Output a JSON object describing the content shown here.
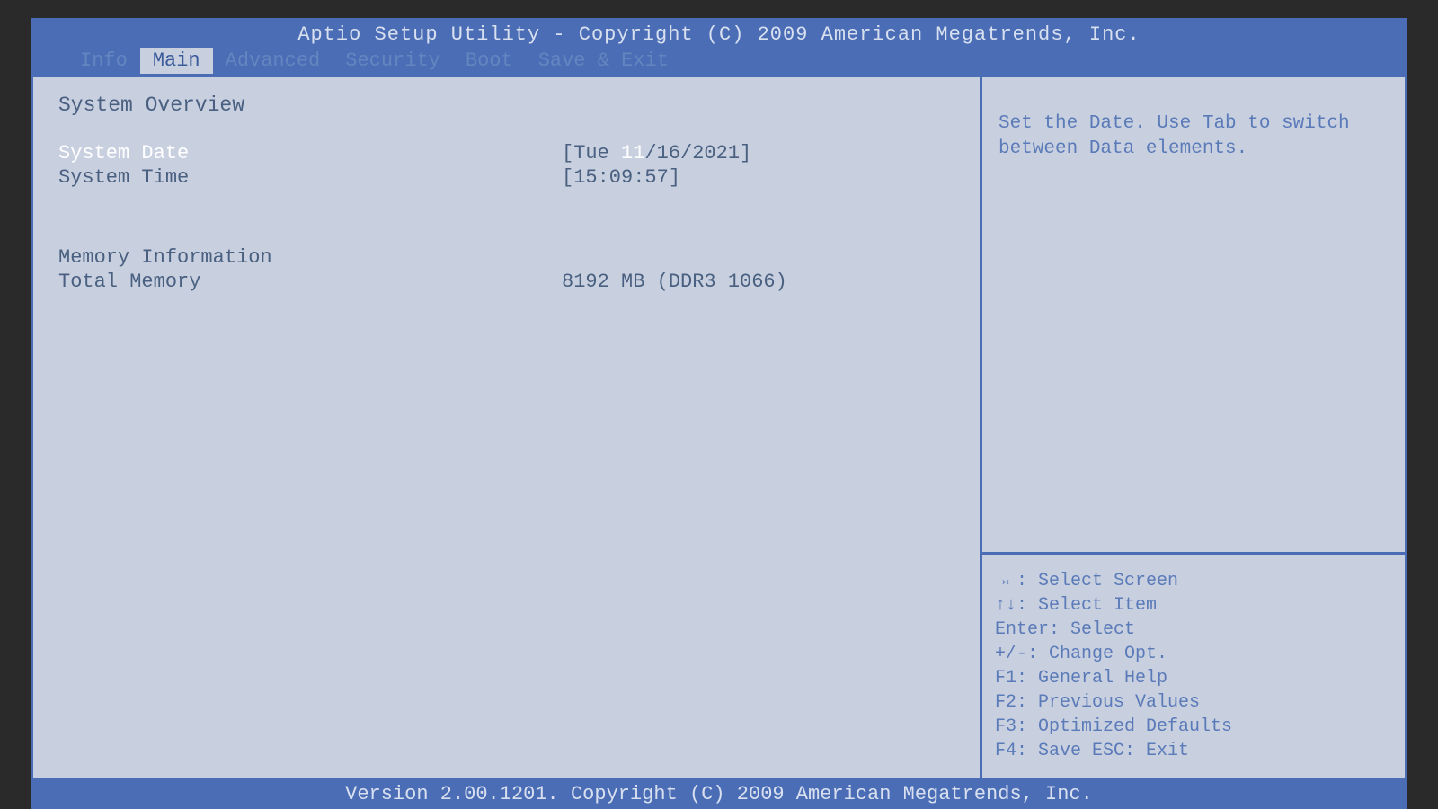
{
  "title": "Aptio Setup Utility - Copyright (C) 2009 American Megatrends, Inc.",
  "tabs": {
    "info": "Info",
    "main": "Main",
    "advanced": "Advanced",
    "security": "Security",
    "boot": "Boot",
    "saveexit": "Save & Exit"
  },
  "main": {
    "section1_heading": "System Overview",
    "date_label": "System Date",
    "date_value_prefix": "[Tue ",
    "date_value_hl": "11",
    "date_value_suffix": "/16/2021]",
    "time_label": "System Time",
    "time_value": "[15:09:57]",
    "section2_heading": "Memory Information",
    "totalmem_label": "Total Memory",
    "totalmem_value": "8192 MB (DDR3 1066)"
  },
  "help": {
    "text": "Set the Date. Use Tab to switch between Data elements."
  },
  "keys": {
    "k1": "→←: Select Screen",
    "k2": "↑↓: Select Item",
    "k3": "Enter: Select",
    "k4": "+/-: Change Opt.",
    "k5": "F1: General Help",
    "k6": "F2: Previous Values",
    "k7": "F3: Optimized Defaults",
    "k8": "F4: Save  ESC: Exit"
  },
  "footer": "Version 2.00.1201. Copyright (C) 2009 American Megatrends, Inc."
}
